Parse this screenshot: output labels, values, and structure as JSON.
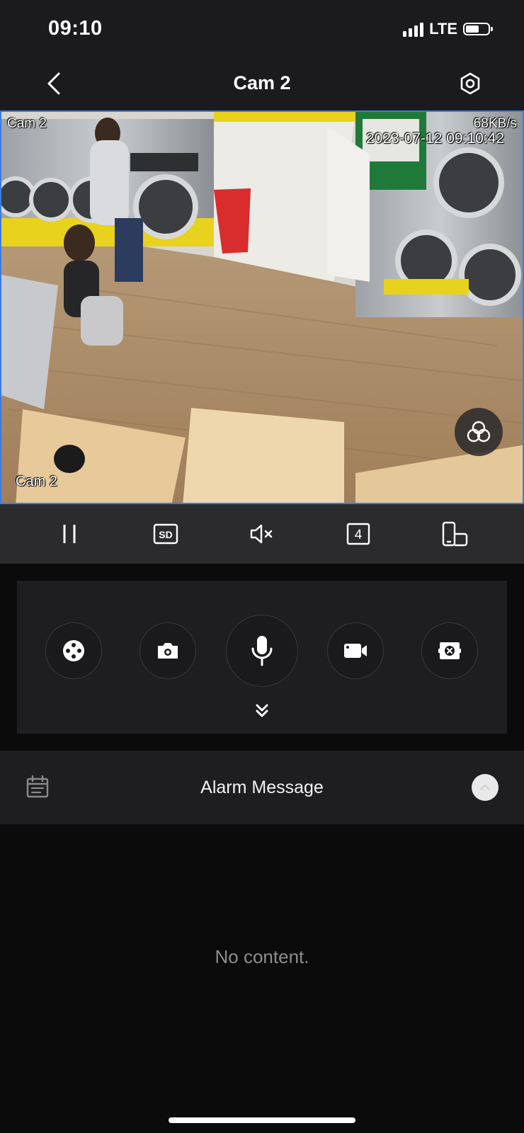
{
  "status_bar": {
    "time": "09:10",
    "network": "LTE",
    "battery_level": 0.6
  },
  "nav": {
    "title": "Cam 2",
    "back_icon": "chevron-left-icon",
    "settings_icon": "settings-hexagon-icon"
  },
  "video": {
    "channel_label_top": "Cam 2",
    "bitrate": "68KB/s",
    "timestamp": "2023-07-12 09:10:42",
    "channel_label_bottom": "Cam 2",
    "border_color": "#3d7be0"
  },
  "controls": [
    {
      "name": "pause",
      "icon": "pause-icon"
    },
    {
      "name": "stream-quality",
      "icon": "sd-icon",
      "label": "SD"
    },
    {
      "name": "mute",
      "icon": "speaker-muted-icon"
    },
    {
      "name": "split-screen",
      "icon": "split-count-icon",
      "label": "4"
    },
    {
      "name": "rotate",
      "icon": "rotate-screen-icon"
    }
  ],
  "actions": [
    {
      "name": "ptz",
      "icon": "ptz-dial-icon"
    },
    {
      "name": "snapshot",
      "icon": "camera-icon"
    },
    {
      "name": "talk",
      "icon": "microphone-icon"
    },
    {
      "name": "record",
      "icon": "video-record-icon"
    },
    {
      "name": "fisheye",
      "icon": "fisheye-icon"
    }
  ],
  "alarm": {
    "title": "Alarm Message",
    "empty_text": "No content."
  }
}
